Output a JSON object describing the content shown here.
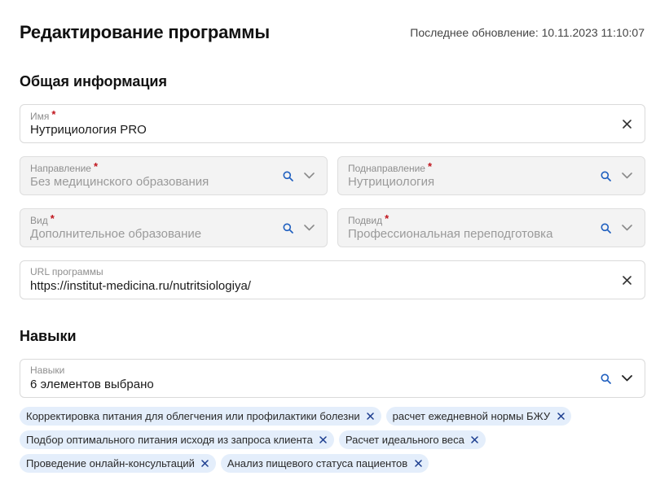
{
  "header": {
    "title": "Редактирование программы",
    "last_updated": "Последнее обновление: 10.11.2023 11:10:07"
  },
  "general": {
    "section_title": "Общая информация",
    "name": {
      "label": "Имя",
      "required_mark": "*",
      "value": "Нутрициология PRO"
    },
    "direction": {
      "label": "Направление",
      "required_mark": "*",
      "value": "Без медицинского образования"
    },
    "subdirection": {
      "label": "Поднаправление",
      "required_mark": "*",
      "value": "Нутрициология"
    },
    "kind": {
      "label": "Вид",
      "required_mark": "*",
      "value": "Дополнительное образование"
    },
    "subkind": {
      "label": "Подвид",
      "required_mark": "*",
      "value": "Профессиональная переподготовка"
    },
    "url": {
      "label": "URL программы",
      "value": "https://institut-medicina.ru/nutritsiologiya/"
    }
  },
  "skills": {
    "section_title": "Навыки",
    "field": {
      "label": "Навыки",
      "value": "6 элементов выбрано"
    },
    "chips": [
      "Корректировка питания для облегчения или профилактики болезни",
      "расчет ежедневной нормы БЖУ",
      "Подбор оптимального питания исходя из запроса клиента",
      "Расчет идеального веса",
      "Проведение онлайн-консультаций",
      "Анализ пищевого статуса пациентов"
    ]
  },
  "colors": {
    "required": "#c0141c",
    "icon_blue": "#1f5fbf",
    "chip_bg": "#e4eefb",
    "disabled_bg": "#f3f3f3"
  },
  "icons": {
    "clear": "close-icon",
    "search": "search-icon",
    "dropdown": "chevron-down-icon",
    "chip_remove": "close-icon"
  }
}
